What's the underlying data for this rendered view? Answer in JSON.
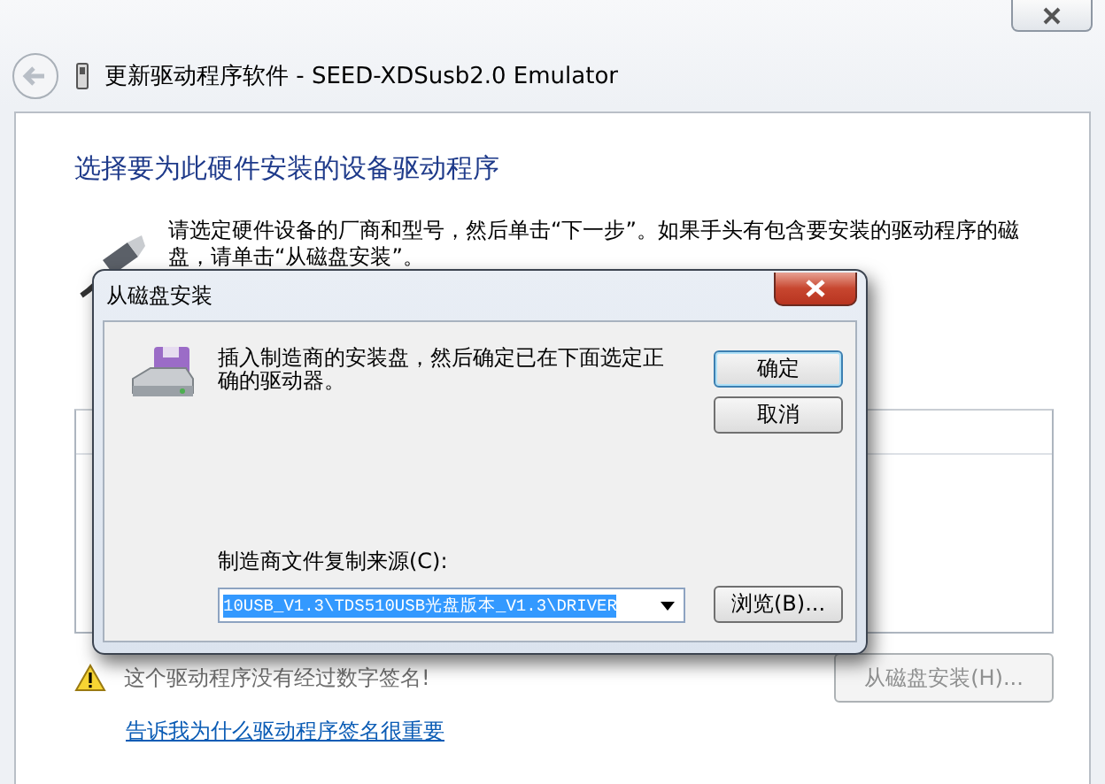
{
  "window": {
    "title": "更新驱动程序软件 - SEED-XDSusb2.0  Emulator"
  },
  "page": {
    "heading": "选择要为此硬件安装的设备驱动程序",
    "instruction": [
      "请选定硬件设备的厂商和型号，然后单击“下一步”。如果手头有包含要安装的驱动程序的磁",
      "盘，请单击“从磁盘安装”。"
    ],
    "warning": "这个驱动程序没有经过数字签名!",
    "have_disk_button": {
      "label": "从磁盘安装(H)...",
      "disabled": true
    },
    "link": "告诉我为什么驱动程序签名很重要"
  },
  "dialog": {
    "title": "从磁盘安装",
    "message": "插入制造商的安装盘，然后确定已在下面选定正确的驱动器。",
    "buttons": [
      {
        "label": "确定",
        "default": true
      },
      {
        "label": "取消",
        "default": false
      }
    ],
    "source_label": "制造商文件复制来源(C):",
    "source_value": "10USB_V1.3\\TDS510USB光盘版本_V1.3\\DRIVER",
    "browse_button": "浏览(B)..."
  }
}
